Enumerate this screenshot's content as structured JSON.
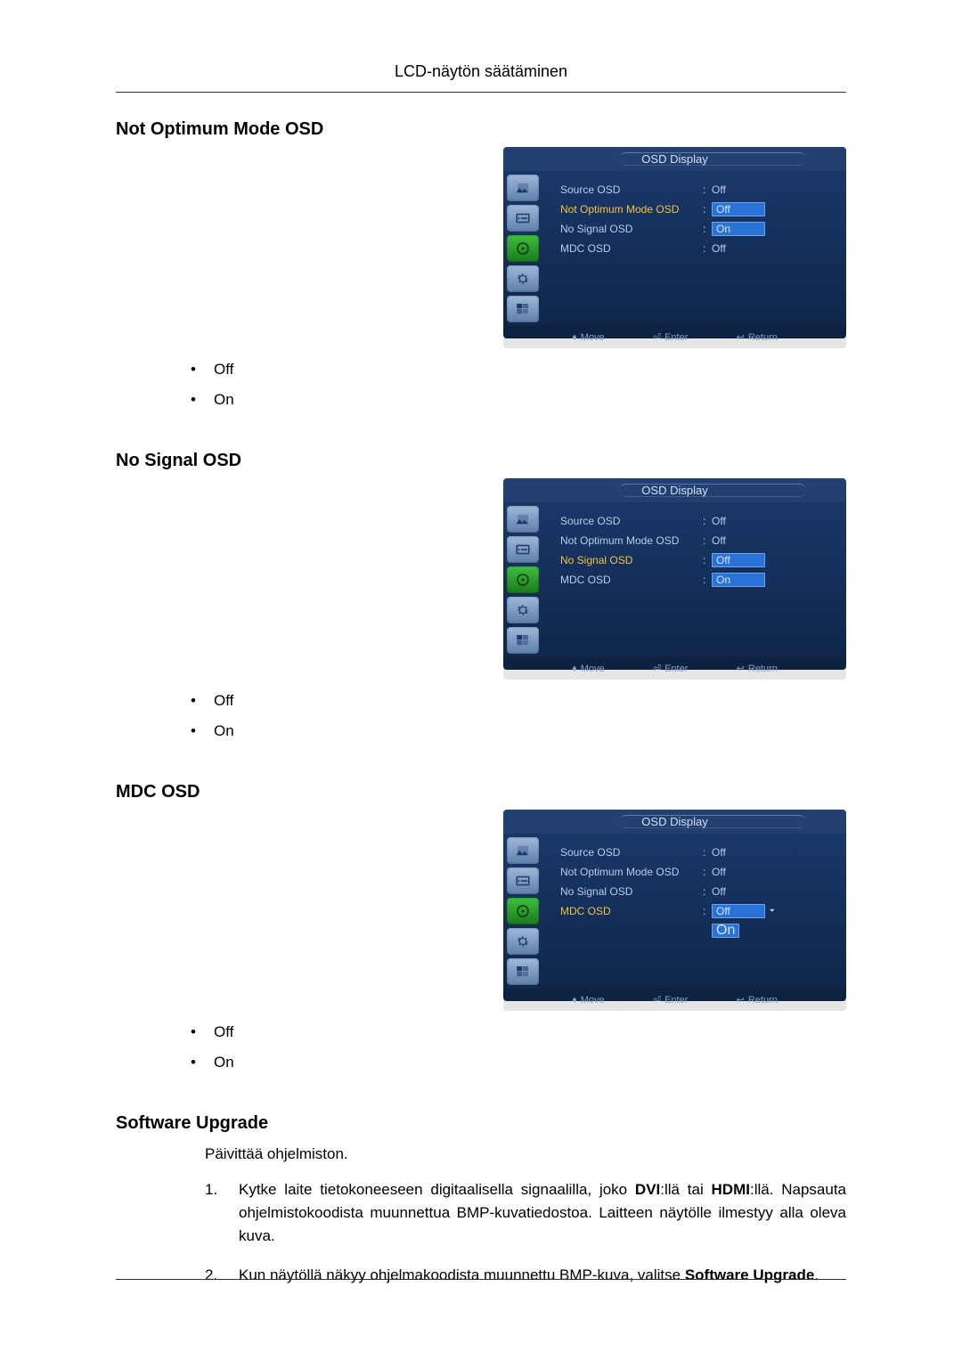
{
  "page_header": "LCD-näytön säätäminen",
  "sections": {
    "not_optimum": {
      "heading": "Not Optimum Mode OSD",
      "bullets": [
        "Off",
        "On"
      ]
    },
    "no_signal": {
      "heading": "No Signal OSD",
      "bullets": [
        "Off",
        "On"
      ]
    },
    "mdc": {
      "heading": "MDC OSD",
      "bullets": [
        "Off",
        "On"
      ]
    },
    "software": {
      "heading": "Software Upgrade",
      "intro": "Päivittää ohjelmiston.",
      "steps": [
        {
          "prefix": "Kytke laite tietokoneeseen digitaalisella signaalilla, joko ",
          "bold1": "DVI",
          "mid1": ":llä tai ",
          "bold2": "HDMI",
          "suffix": ":llä. Napsauta ohjelmistokoodista muunnettua BMP-kuvatiedostoa. Laitteen näytölle ilmestyy alla oleva kuva."
        },
        {
          "prefix": "Kun näytöllä näkyy ohjelmakoodista muunnettu BMP-kuva, valitse ",
          "bold1": "Software Upgrade",
          "suffix": "."
        }
      ]
    }
  },
  "osd": {
    "title": "OSD Display",
    "labels": {
      "source": "Source OSD",
      "not_optimum": "Not Optimum Mode OSD",
      "no_signal": "No Signal OSD",
      "mdc": "MDC OSD"
    },
    "values": {
      "off": "Off",
      "on": "On"
    },
    "footer": {
      "move": "Move",
      "enter": "Enter",
      "return": "Return"
    }
  },
  "panels": {
    "p1": {
      "rows": [
        {
          "key": "source",
          "value": "off",
          "highlight": false,
          "selected": false
        },
        {
          "key": "not_optimum",
          "value": "off",
          "highlight": true,
          "selected": true
        },
        {
          "key": "no_signal",
          "value": "on",
          "highlight": false,
          "selected": true
        },
        {
          "key": "mdc",
          "value": "off",
          "highlight": false,
          "selected": false
        }
      ]
    },
    "p2": {
      "rows": [
        {
          "key": "source",
          "value": "off",
          "highlight": false,
          "selected": false
        },
        {
          "key": "not_optimum",
          "value": "off",
          "highlight": false,
          "selected": false
        },
        {
          "key": "no_signal",
          "value": "off",
          "highlight": true,
          "selected": true
        },
        {
          "key": "mdc",
          "value": "on",
          "highlight": false,
          "selected": true
        }
      ]
    },
    "p3": {
      "rows": [
        {
          "key": "source",
          "value": "off",
          "highlight": false,
          "selected": false
        },
        {
          "key": "not_optimum",
          "value": "off",
          "highlight": false,
          "selected": false
        },
        {
          "key": "no_signal",
          "value": "off",
          "highlight": false,
          "selected": false
        },
        {
          "key": "mdc",
          "value": "off",
          "highlight": true,
          "selected": true,
          "dropdown_extra": "on"
        }
      ]
    }
  }
}
